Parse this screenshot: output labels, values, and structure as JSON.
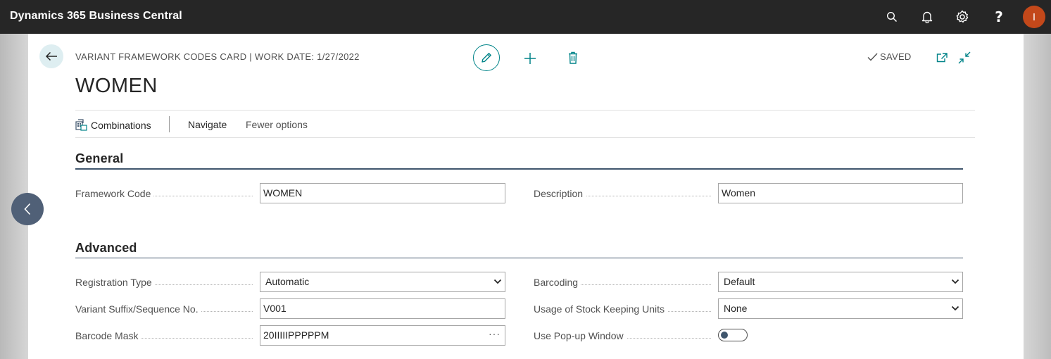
{
  "app": {
    "title": "Dynamics 365 Business Central"
  },
  "topbar_icons": [
    "search-icon",
    "bell-icon",
    "gear-icon",
    "help-icon"
  ],
  "help_glyph": "?",
  "user": {
    "avatar_initial": "I",
    "avatar_color": "#c3481a"
  },
  "header": {
    "breadcrumb": "VARIANT FRAMEWORK CODES CARD | WORK DATE: 1/27/2022",
    "title": "WOMEN",
    "status": "SAVED"
  },
  "actions": [
    {
      "label": "Combinations",
      "icon": "combinations-icon"
    },
    {
      "label": "Navigate"
    },
    {
      "label": "Fewer options"
    }
  ],
  "sections": {
    "general": {
      "title": "General",
      "fields": {
        "framework_code": {
          "label": "Framework Code",
          "value": "WOMEN"
        },
        "description": {
          "label": "Description",
          "value": "Women"
        }
      }
    },
    "advanced": {
      "title": "Advanced",
      "fields": {
        "registration_type": {
          "label": "Registration Type",
          "value": "Automatic"
        },
        "variant_suffix": {
          "label": "Variant Suffix/Sequence No.",
          "value": "V001"
        },
        "barcode_mask": {
          "label": "Barcode Mask",
          "value": "20IIIIIPPPPPM",
          "assist": "···"
        },
        "barcoding": {
          "label": "Barcoding",
          "value": "Default"
        },
        "usage_sku": {
          "label": "Usage of Stock Keeping Units",
          "value": "None"
        },
        "use_popup": {
          "label": "Use Pop-up Window",
          "value": false
        }
      }
    }
  },
  "colors": {
    "accent": "#008489",
    "topbar": "#262626",
    "section_rule": "#40566d"
  }
}
